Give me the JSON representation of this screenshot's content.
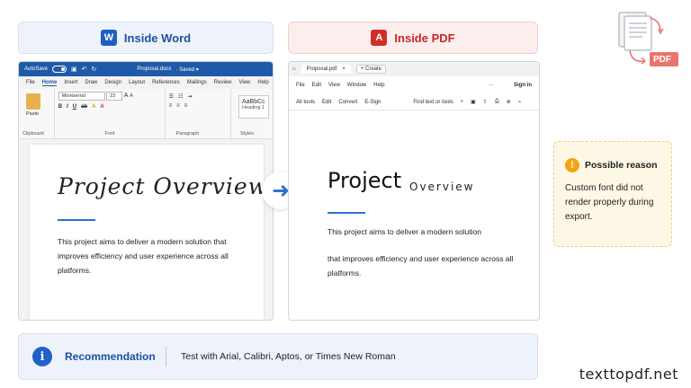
{
  "headers": {
    "word": {
      "badge": "W",
      "title": "Inside Word"
    },
    "pdf": {
      "badge": "A",
      "title": "Inside PDF"
    }
  },
  "word": {
    "titlebar": {
      "autosave": "AutoSave",
      "filename": "Proposal.docx",
      "status": "· Saved ▾"
    },
    "menu": [
      "File",
      "Home",
      "Insert",
      "Draw",
      "Design",
      "Layout",
      "References",
      "Mailings",
      "Review",
      "View",
      "Help"
    ],
    "ribbon": {
      "paste": "Paste",
      "clipboard": "Clipboard",
      "font_name": "Montserrat",
      "font_size": "22",
      "font_group": "Font",
      "paragraph_group": "Paragraph",
      "style_sample": "AaBbCc",
      "style_name": "Heading 1",
      "styles_group": "Styles"
    },
    "doc": {
      "heading": "Project Overview",
      "body": "This project aims to deliver a modern solution that improves efficiency and user experience across all platforms."
    }
  },
  "pdf": {
    "tab": "Proposal.pdf",
    "create": "+ Create",
    "menu": [
      "File",
      "Edit",
      "View",
      "Window",
      "Help"
    ],
    "more": "···",
    "sign_in": "Sign in",
    "tools": [
      "All tools",
      "Edit",
      "Convert",
      "E-Sign"
    ],
    "find": "Find text or tools",
    "doc": {
      "heading": "Project",
      "subheading": "Overview",
      "line1": "This project aims to deliver a modern solution",
      "line2": "that improves efficiency and user experience across all platforms."
    }
  },
  "reason": {
    "title": "Possible reason",
    "body": "Custom font did not render properly during export."
  },
  "recommendation": {
    "label": "Recommendation",
    "text": "Test with Arial, Calibri, Aptos, or Times New Roman"
  },
  "graphic": {
    "label": "PDF"
  },
  "watermark": "texttopdf.net",
  "colors": {
    "word_blue": "#1f5aa8",
    "pdf_red": "#d32d27",
    "accent_blue": "#2f6fd1",
    "warning": "#f2a515"
  }
}
